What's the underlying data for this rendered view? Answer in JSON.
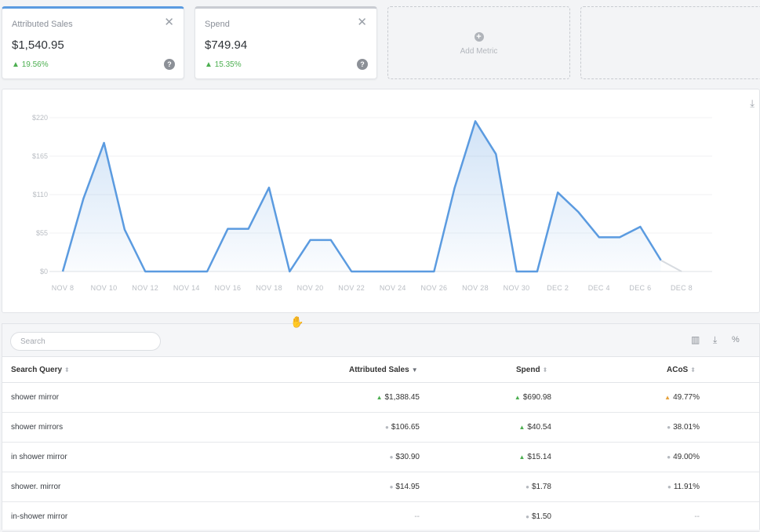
{
  "cards": [
    {
      "title": "Attributed Sales",
      "value": "$1,540.95",
      "delta": "19.56%",
      "close": "✕",
      "help": "?"
    },
    {
      "title": "Spend",
      "value": "$749.94",
      "delta": "15.35%",
      "close": "✕",
      "help": "?"
    }
  ],
  "add_metric": {
    "label": "Add Metric",
    "icon": "+"
  },
  "chart_data": {
    "type": "area",
    "x": [
      "NOV 8",
      "NOV 9",
      "NOV 10",
      "NOV 11",
      "NOV 12",
      "NOV 13",
      "NOV 14",
      "NOV 15",
      "NOV 16",
      "NOV 17",
      "NOV 18",
      "NOV 19",
      "NOV 20",
      "NOV 21",
      "NOV 22",
      "NOV 23",
      "NOV 24",
      "NOV 25",
      "NOV 26",
      "NOV 27",
      "NOV 28",
      "NOV 29",
      "NOV 30",
      "DEC 1",
      "DEC 2",
      "DEC 3",
      "DEC 4",
      "DEC 5",
      "DEC 6",
      "DEC 7"
    ],
    "xticks": [
      "NOV 8",
      "NOV 10",
      "NOV 12",
      "NOV 14",
      "NOV 16",
      "NOV 18",
      "NOV 20",
      "NOV 22",
      "NOV 24",
      "NOV 26",
      "NOV 28",
      "NOV 30",
      "DEC 2",
      "DEC 4",
      "DEC 6",
      "DEC 8"
    ],
    "yticks": [
      "$0",
      "$55",
      "$110",
      "$165",
      "$220"
    ],
    "ylim": [
      0,
      220
    ],
    "values": [
      0,
      104,
      184,
      60,
      0,
      0,
      0,
      0,
      61,
      61,
      120,
      0,
      45,
      45,
      0,
      0,
      0,
      0,
      0,
      120,
      215,
      168,
      0,
      0,
      113,
      85,
      49,
      49,
      64,
      16
    ],
    "color": "#5b9be0",
    "grid": true
  },
  "table": {
    "search_placeholder": "Search",
    "icons": {
      "columns": "▥",
      "download": "⤓",
      "percent": "%"
    },
    "headers": {
      "query": "Search Query",
      "sales": "Attributed Sales",
      "spend": "Spend",
      "acos": "ACoS"
    },
    "sort_icons": {
      "query": "⬍",
      "sales": "▼",
      "spend": "⬍",
      "acos": "⬍"
    },
    "rows": [
      {
        "query": "shower mirror",
        "sales": "$1,388.45",
        "spend": "$690.98",
        "acos": "49.77%"
      },
      {
        "query": "shower mirrors",
        "sales": "$106.65",
        "spend": "$40.54",
        "acos": "38.01%"
      },
      {
        "query": "in shower mirror",
        "sales": "$30.90",
        "spend": "$15.14",
        "acos": "49.00%"
      },
      {
        "query": "shower. mirror",
        "sales": "$14.95",
        "spend": "$1.78",
        "acos": "11.91%"
      },
      {
        "query": "in-shower mirror",
        "sales": "--",
        "spend": "$1.50",
        "acos": "--"
      }
    ]
  },
  "chart_download_icon": "⤓",
  "colors": {
    "accent": "#5b9be0",
    "up": "#4caf50",
    "warn": "#e6a23c"
  }
}
